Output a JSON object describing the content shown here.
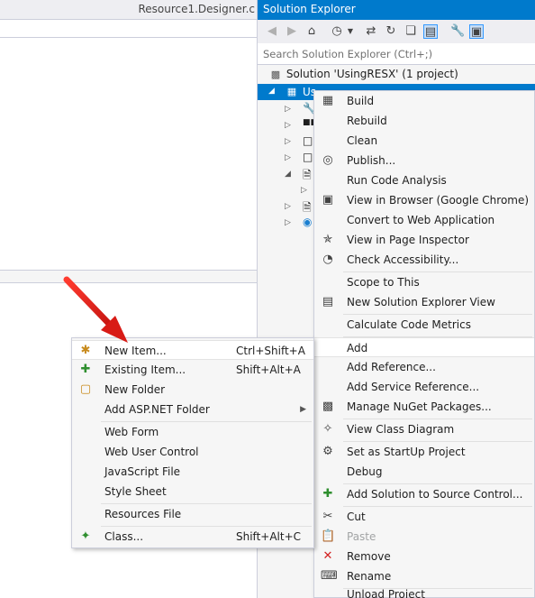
{
  "editor": {
    "tab_title": "Resource1.Designer.c"
  },
  "solution_explorer": {
    "title": "Solution Explorer",
    "search_placeholder": "Search Solution Explorer (Ctrl+;)",
    "toolbar_icons": [
      "back-icon",
      "forward-icon",
      "home-icon",
      "history-icon",
      "sync-icon",
      "refresh-icon",
      "collapse-all-icon",
      "show-all-files-icon",
      "properties-icon",
      "preview-icon"
    ],
    "solution_label": "Solution 'UsingRESX' (1 project)",
    "project_label_partial": "Us"
  },
  "main_menu": {
    "items": [
      {
        "label": "Build",
        "icon": "build-icon"
      },
      {
        "label": "Rebuild",
        "icon": ""
      },
      {
        "label": "Clean",
        "icon": ""
      },
      {
        "label": "Publish...",
        "icon": "publish-icon"
      },
      {
        "label": "Run Code Analysis",
        "icon": ""
      },
      {
        "label": "View in Browser (Google Chrome)",
        "icon": "browser-icon"
      },
      {
        "label": "Convert to Web Application",
        "icon": ""
      },
      {
        "label": "View in Page Inspector",
        "icon": "page-inspector-icon"
      },
      {
        "label": "Check Accessibility...",
        "icon": "accessibility-icon"
      },
      {
        "label": "Scope to This",
        "icon": ""
      },
      {
        "label": "New Solution Explorer View",
        "icon": "new-view-icon"
      },
      {
        "label": "Calculate Code Metrics",
        "icon": ""
      },
      {
        "label": "Add",
        "icon": ""
      },
      {
        "label": "Add Reference...",
        "icon": ""
      },
      {
        "label": "Add Service Reference...",
        "icon": ""
      },
      {
        "label": "Manage NuGet Packages...",
        "icon": "nuget-icon"
      },
      {
        "label": "View Class Diagram",
        "icon": "class-diagram-icon"
      },
      {
        "label": "Set as StartUp Project",
        "icon": "gear-icon"
      },
      {
        "label": "Debug",
        "icon": ""
      },
      {
        "label": "Add Solution to Source Control...",
        "icon": "source-control-icon"
      },
      {
        "label": "Cut",
        "icon": "cut-icon"
      },
      {
        "label": "Paste",
        "icon": "paste-icon"
      },
      {
        "label": "Remove",
        "icon": "remove-icon"
      },
      {
        "label": "Rename",
        "icon": "rename-icon"
      },
      {
        "label": "Unload Project",
        "icon": ""
      }
    ]
  },
  "add_menu": {
    "items": [
      {
        "label": "New Item...",
        "shortcut": "Ctrl+Shift+A",
        "icon": "new-item-icon"
      },
      {
        "label": "Existing Item...",
        "shortcut": "Shift+Alt+A",
        "icon": "existing-item-icon"
      },
      {
        "label": "New Folder",
        "shortcut": "",
        "icon": "new-folder-icon"
      },
      {
        "label": "Add ASP.NET Folder",
        "shortcut": "",
        "icon": ""
      },
      {
        "label": "Web Form",
        "shortcut": "",
        "icon": ""
      },
      {
        "label": "Web User Control",
        "shortcut": "",
        "icon": ""
      },
      {
        "label": "JavaScript File",
        "shortcut": "",
        "icon": ""
      },
      {
        "label": "Style Sheet",
        "shortcut": "",
        "icon": ""
      },
      {
        "label": "Resources File",
        "shortcut": "",
        "icon": ""
      },
      {
        "label": "Class...",
        "shortcut": "Shift+Alt+C",
        "icon": "class-icon"
      }
    ]
  },
  "colors": {
    "accent": "#007acc",
    "menu_bg": "#f6f6f6",
    "annotation_arrow": "#e8231f"
  }
}
